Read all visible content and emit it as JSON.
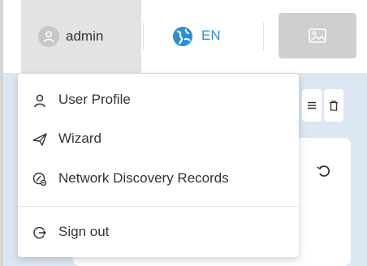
{
  "header": {
    "user": {
      "name": "admin",
      "icon": "user-icon"
    },
    "language": {
      "label": "EN",
      "icon": "globe-icon",
      "color": "#2a8fd8"
    },
    "image_button": {
      "icon": "image-icon"
    }
  },
  "toolbar": {
    "menu_icon": "hamburger-icon",
    "delete_icon": "trash-icon",
    "refresh_icon": "refresh-icon"
  },
  "user_menu": {
    "items": [
      {
        "label": "User Profile",
        "icon": "user-icon"
      },
      {
        "label": "Wizard",
        "icon": "paper-plane-icon"
      },
      {
        "label": "Network Discovery Records",
        "icon": "discovery-icon"
      },
      {
        "label": "Sign out",
        "icon": "sign-out-icon"
      }
    ]
  },
  "colors": {
    "accent": "#2a8fd8",
    "content_background": "#dbe7f3"
  }
}
